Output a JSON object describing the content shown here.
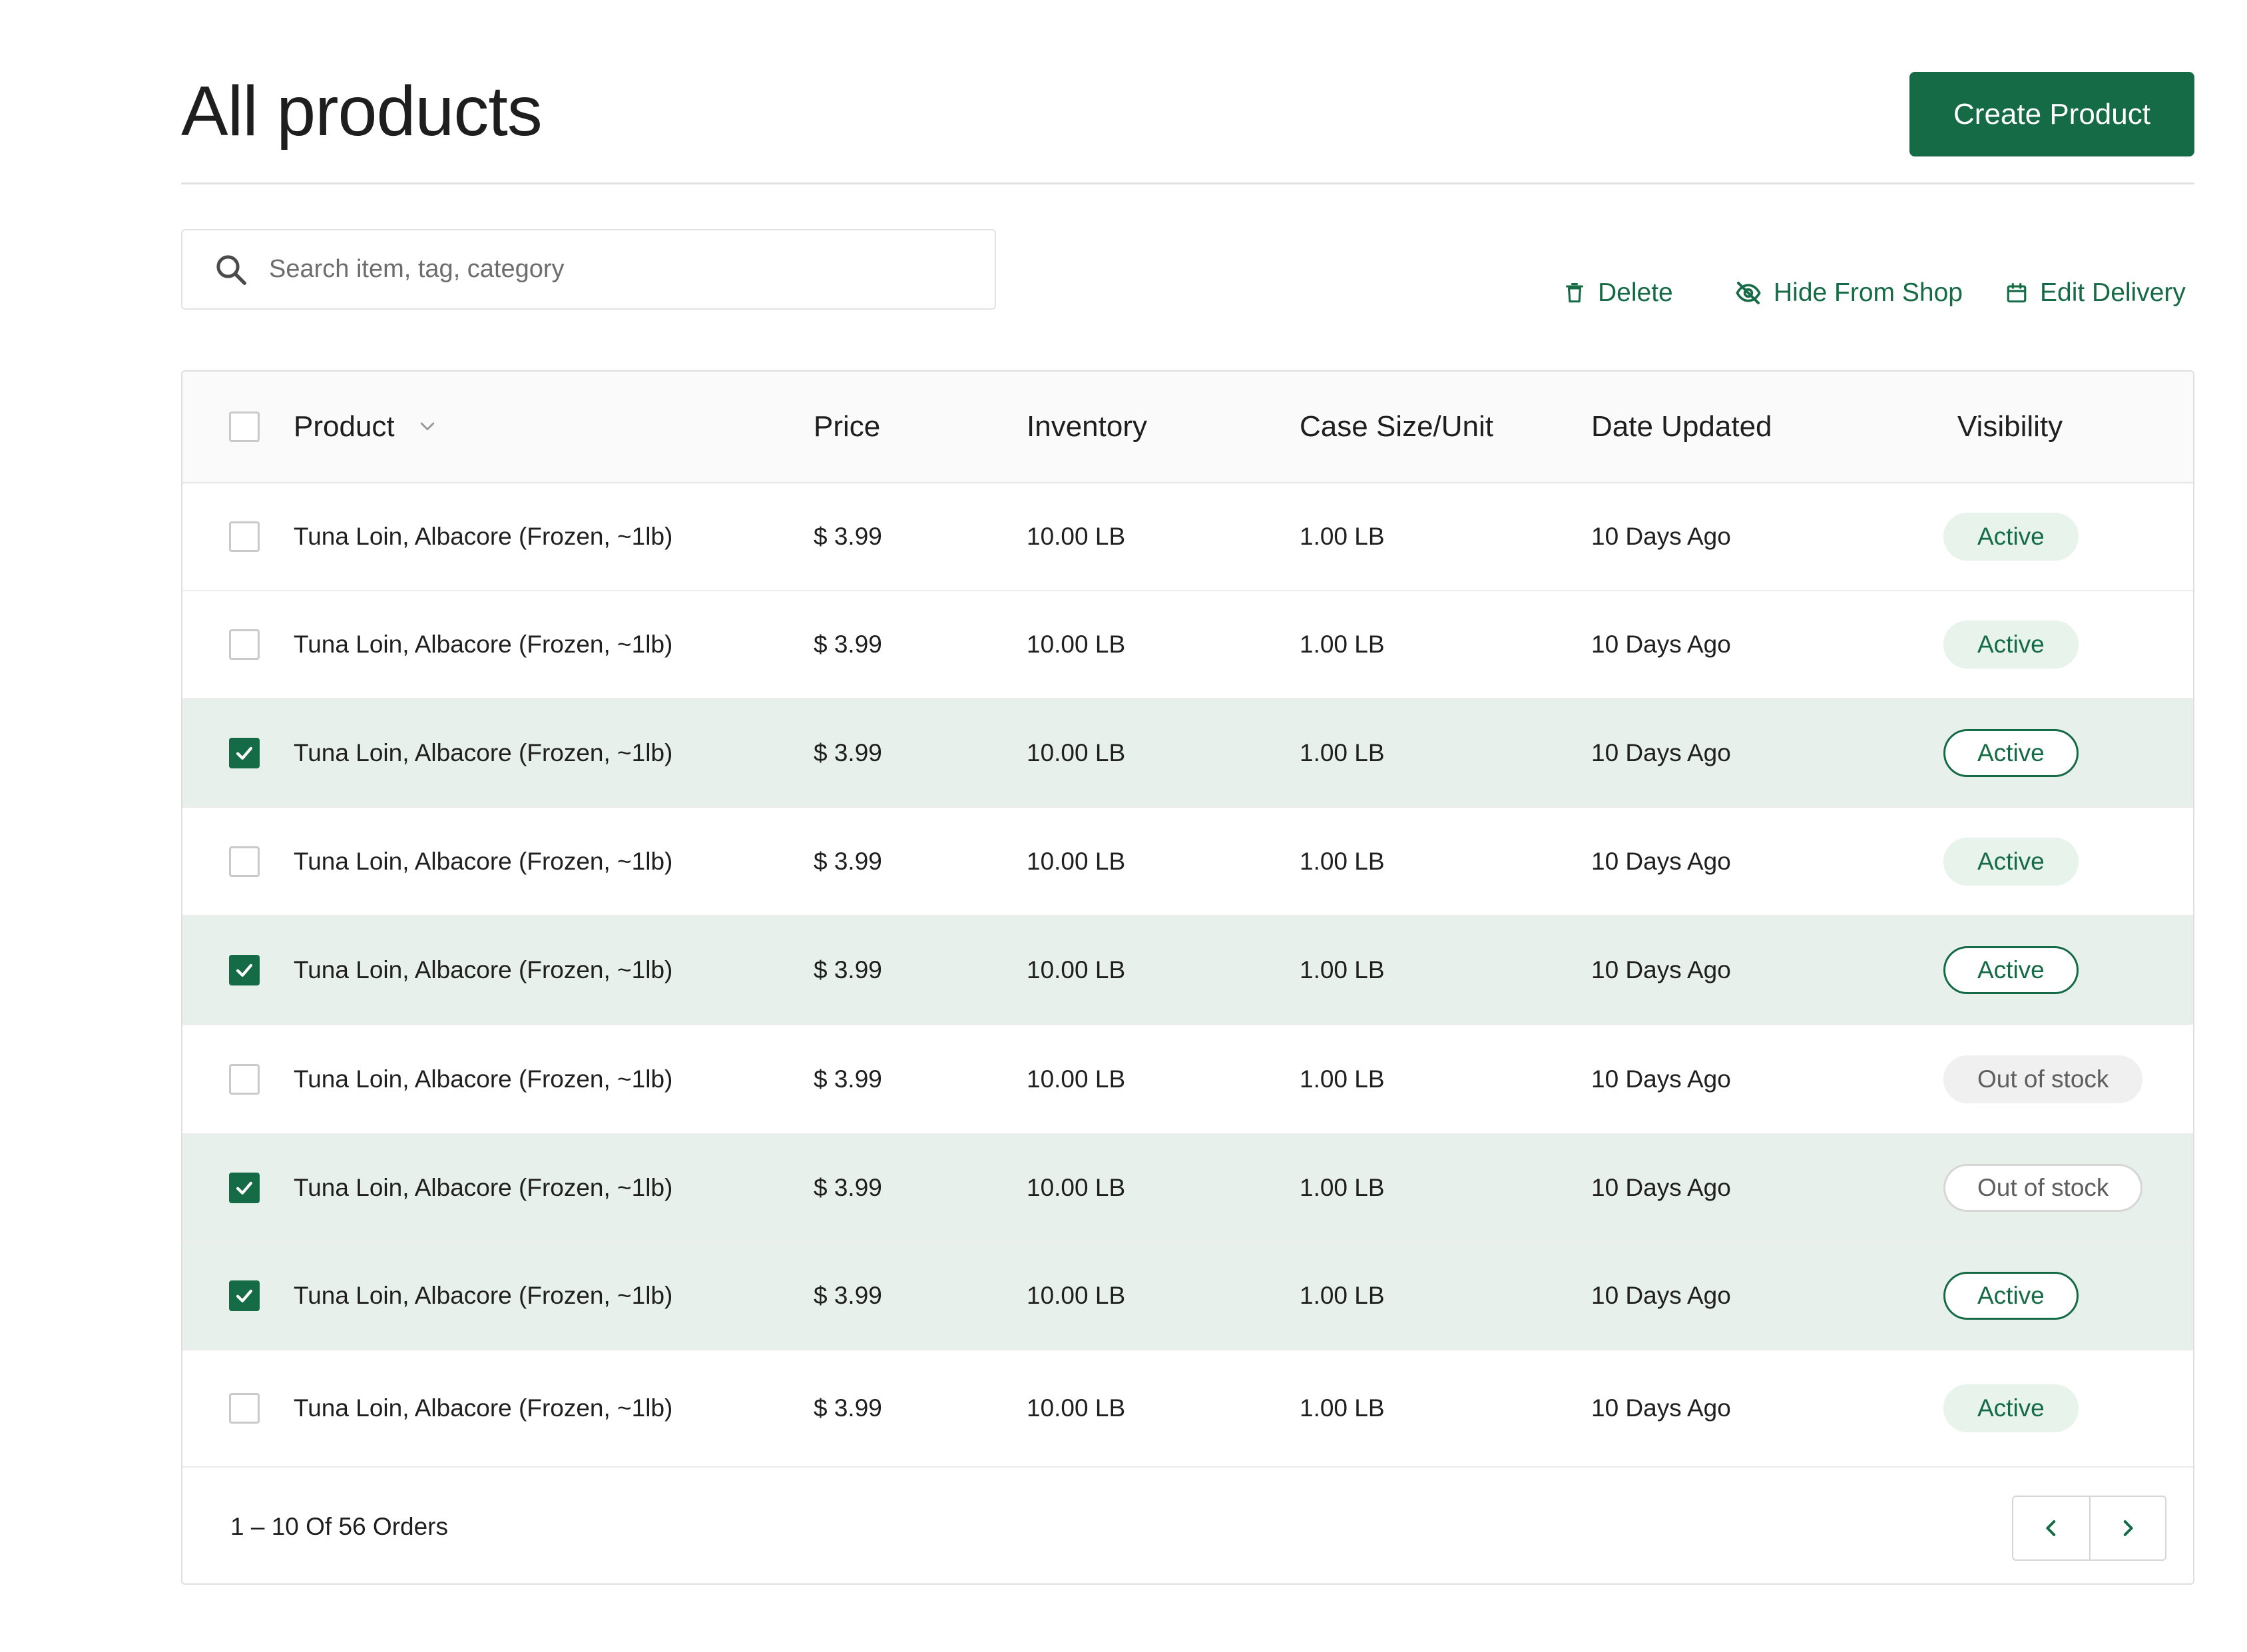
{
  "header": {
    "title": "All products",
    "create_label": "Create Product"
  },
  "search": {
    "placeholder": "Search item, tag, category",
    "value": ""
  },
  "actions": {
    "delete_label": "Delete",
    "hide_label": "Hide From Shop",
    "edit_label": "Edit Delivery"
  },
  "table": {
    "columns": {
      "product": "Product",
      "price": "Price",
      "inventory": "Inventory",
      "case_size": "Case Size/Unit",
      "date_updated": "Date Updated",
      "visibility": "Visibility"
    },
    "rows": [
      {
        "product": "Tuna Loin, Albacore (Frozen, ~1lb)",
        "price": "$ 3.99",
        "inventory": "10.00 LB",
        "case_size": "1.00 LB",
        "date_updated": "10 Days Ago",
        "visibility": "Active",
        "selected": false
      },
      {
        "product": "Tuna Loin, Albacore (Frozen, ~1lb)",
        "price": "$ 3.99",
        "inventory": "10.00 LB",
        "case_size": "1.00 LB",
        "date_updated": "10 Days Ago",
        "visibility": "Active",
        "selected": false
      },
      {
        "product": "Tuna Loin, Albacore (Frozen, ~1lb)",
        "price": "$ 3.99",
        "inventory": "10.00 LB",
        "case_size": "1.00 LB",
        "date_updated": "10 Days Ago",
        "visibility": "Active",
        "selected": true
      },
      {
        "product": "Tuna Loin, Albacore (Frozen, ~1lb)",
        "price": "$ 3.99",
        "inventory": "10.00 LB",
        "case_size": "1.00 LB",
        "date_updated": "10 Days Ago",
        "visibility": "Active",
        "selected": false
      },
      {
        "product": "Tuna Loin, Albacore (Frozen, ~1lb)",
        "price": "$ 3.99",
        "inventory": "10.00 LB",
        "case_size": "1.00 LB",
        "date_updated": "10 Days Ago",
        "visibility": "Active",
        "selected": true
      },
      {
        "product": "Tuna Loin, Albacore (Frozen, ~1lb)",
        "price": "$ 3.99",
        "inventory": "10.00 LB",
        "case_size": "1.00 LB",
        "date_updated": "10 Days Ago",
        "visibility": "Out of stock",
        "selected": false
      },
      {
        "product": "Tuna Loin, Albacore (Frozen, ~1lb)",
        "price": "$ 3.99",
        "inventory": "10.00 LB",
        "case_size": "1.00 LB",
        "date_updated": "10 Days Ago",
        "visibility": "Out of stock",
        "selected": true
      },
      {
        "product": "Tuna Loin, Albacore (Frozen, ~1lb)",
        "price": "$ 3.99",
        "inventory": "10.00 LB",
        "case_size": "1.00 LB",
        "date_updated": "10 Days Ago",
        "visibility": "Active",
        "selected": true
      },
      {
        "product": "Tuna Loin, Albacore (Frozen, ~1lb)",
        "price": "$ 3.99",
        "inventory": "10.00 LB",
        "case_size": "1.00 LB",
        "date_updated": "10 Days Ago",
        "visibility": "Active",
        "selected": false
      }
    ]
  },
  "pagination": {
    "summary": "1 – 10 Of 56 Orders"
  },
  "icons": {
    "search": "search-icon",
    "delete": "trash-icon",
    "hide": "eye-off-icon",
    "edit_delivery": "calendar-icon",
    "sort": "chevron-down-icon",
    "prev": "chevron-left-icon",
    "next": "chevron-right-icon",
    "check": "check-icon"
  },
  "colors": {
    "brand": "#146b45",
    "selected_row": "#e8f0ec",
    "active_badge_bg": "#e8f3ec",
    "oos_badge_bg": "#f0f0f0"
  }
}
